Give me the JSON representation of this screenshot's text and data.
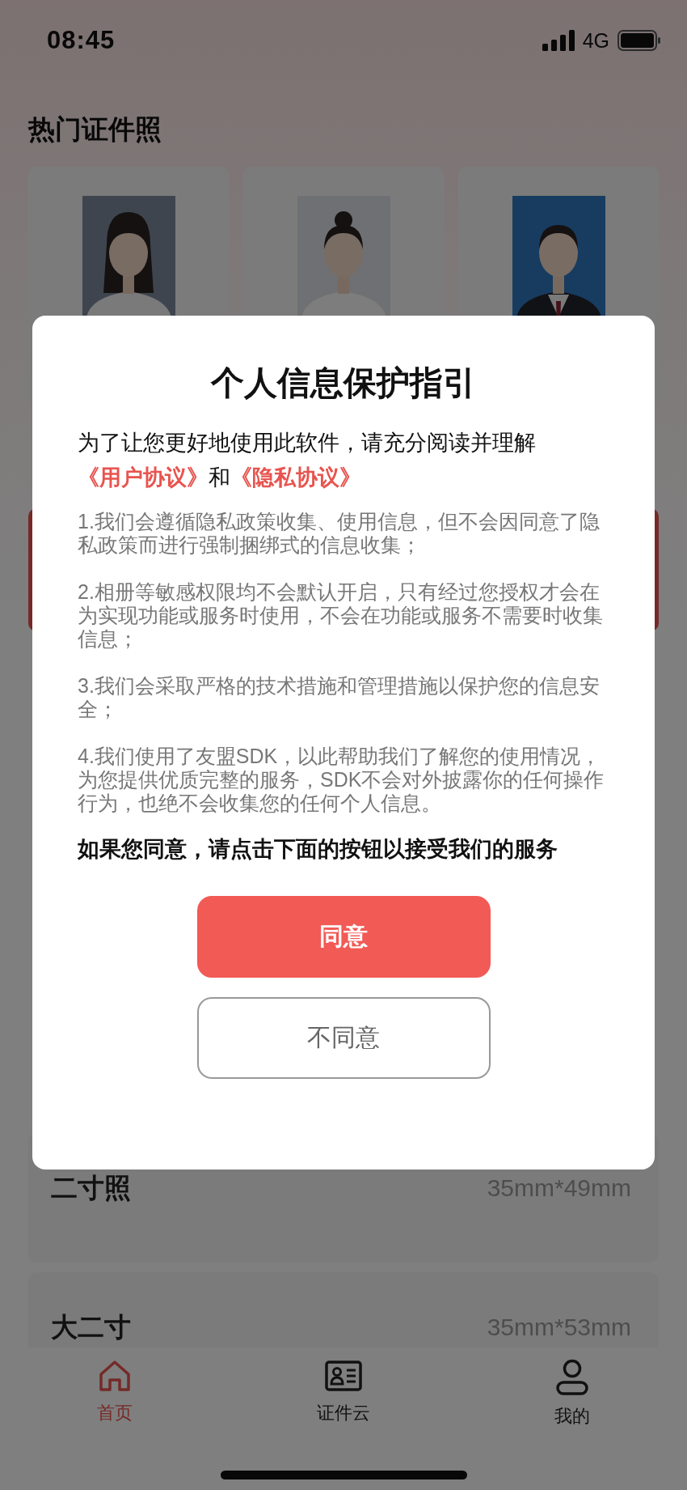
{
  "status_bar": {
    "time": "08:45",
    "network": "4G"
  },
  "section_title": "热门证件照",
  "size_rows": [
    {
      "name": "二寸照",
      "size": "35mm*49mm"
    },
    {
      "name": "大二寸",
      "size": "35mm*53mm"
    }
  ],
  "dialog": {
    "title": "个人信息保护指引",
    "intro": [
      {
        "kind": "text",
        "text": "为了让您更好地使用此软件，请充分阅读并理解"
      },
      {
        "kind": "link",
        "text": "《用户协议》"
      },
      {
        "kind": "text",
        "text": "和"
      },
      {
        "kind": "link",
        "text": "《隐私协议》"
      }
    ],
    "points": [
      "1.我们会遵循隐私政策收集、使用信息，但不会因同意了隐私政策而进行强制捆绑式的信息收集；",
      "2.相册等敏感权限均不会默认开启，只有经过您授权才会在为实现功能或服务时使用，不会在功能或服务不需要时收集信息；",
      "3.我们会采取严格的技术措施和管理措施以保护您的信息安全；",
      "4.我们使用了友盟SDK，以此帮助我们了解您的使用情况，为您提供优质完整的服务，SDK不会对外披露你的任何操作行为，也绝不会收集您的任何个人信息。"
    ],
    "notice": "如果您同意，请点击下面的按钮以接受我们的服务",
    "buttons": [
      {
        "kind": "primary",
        "label": "同意"
      },
      {
        "kind": "secondary",
        "label": "不同意"
      }
    ]
  },
  "tabs": [
    {
      "label": "首页",
      "selected": true
    },
    {
      "label": "证件云",
      "selected": false
    },
    {
      "label": "我的",
      "selected": false
    }
  ]
}
